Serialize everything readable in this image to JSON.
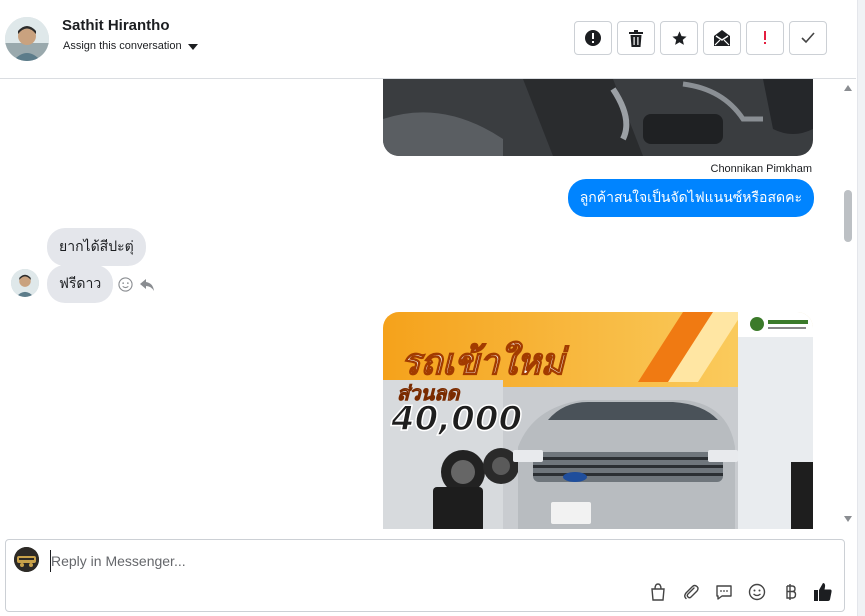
{
  "header": {
    "contact_name": "Sathit Hirantho",
    "assign_label": "Assign this conversation",
    "toolbar": [
      {
        "name": "spam-button",
        "icon": "alert-circle-icon"
      },
      {
        "name": "delete-button",
        "icon": "trash-icon"
      },
      {
        "name": "star-button",
        "icon": "star-icon"
      },
      {
        "name": "mark-unread-button",
        "icon": "mail-open-icon"
      },
      {
        "name": "important-button",
        "icon": "exclamation-icon",
        "color": "#e41e3f"
      },
      {
        "name": "done-button",
        "icon": "check-icon"
      }
    ]
  },
  "thread": {
    "sender_name": "Chonnikan Pimkham",
    "outgoing_message": "ลูกค้าสนใจเป็นจัดไฟแนนซ์หรือสดคะ",
    "incoming_messages": [
      "ยากได้สีปะตุ่",
      "ฟรีดาว"
    ],
    "ad_image": {
      "headline": "รถเข้าใหม่",
      "subline": "ส่วนลด",
      "discount": "40,000"
    }
  },
  "composer": {
    "placeholder": "Reply in Messenger..."
  },
  "colors": {
    "accent": "#0084ff",
    "incoming_bubble": "#e4e6eb",
    "danger": "#e41e3f",
    "ad_orange": "#f39200"
  }
}
